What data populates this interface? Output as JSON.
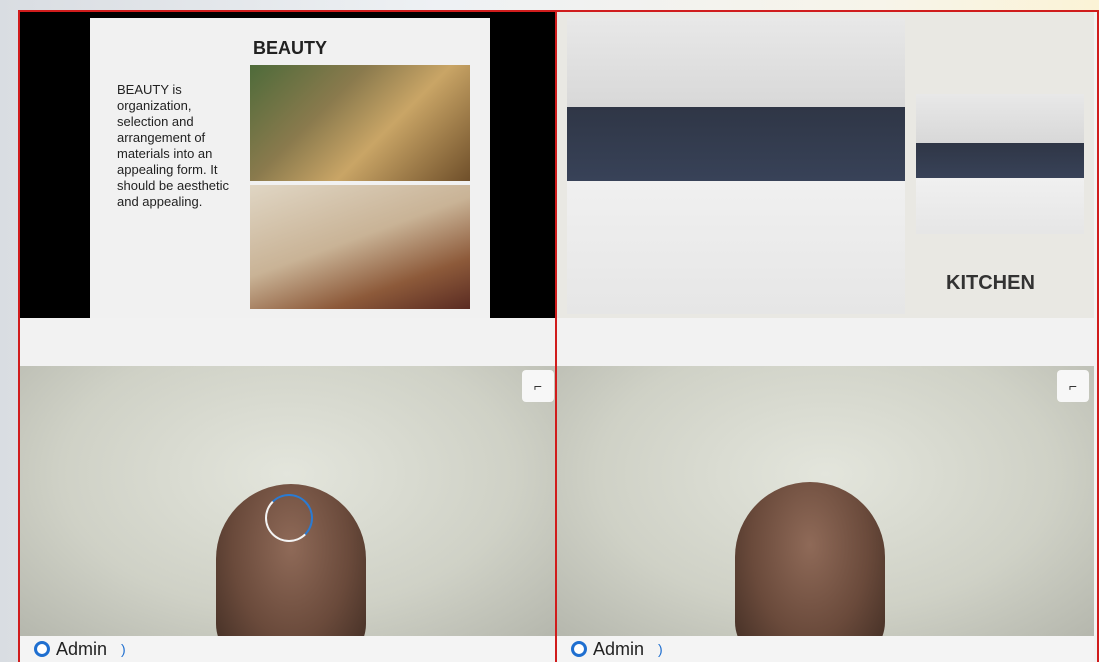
{
  "left_slide": {
    "title": "BEAUTY",
    "text": "BEAUTY is organization, selection and arrangement of materials into an appealing form. It should be aesthetic and appealing."
  },
  "right_slide": {
    "label": "KITCHEN"
  },
  "tiles": [
    {
      "name": "Admin",
      "expand_glyph": "⌐"
    },
    {
      "name": "Admin",
      "expand_glyph": "⌐"
    }
  ],
  "colors": {
    "border": "#d01c1c",
    "accent": "#1f6fd0"
  }
}
